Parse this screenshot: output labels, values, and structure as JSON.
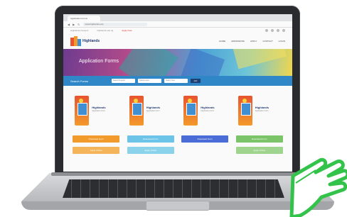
{
  "browser": {
    "tab_title": "Application Forms",
    "url": "www.highlands.edu"
  },
  "site": {
    "top_links": [
      "Highlands Campus",
      "highlands.edu.ng"
    ],
    "alert": "Apply Now",
    "logo_name": "Highlands",
    "menu": [
      "HOME",
      "ADMISSIONS",
      "APPLY",
      "CONTACT",
      "LOGIN"
    ],
    "hero_title": "Application Forms",
    "search_label": "Search Forms",
    "search_fields": [
      "Select Program",
      "Select Level",
      "Select Year"
    ],
    "search_button": "GO",
    "cards": [
      {
        "brand": "Highlands",
        "subtitle": "Application Form"
      },
      {
        "brand": "Highlands",
        "subtitle": "Application Form"
      },
      {
        "brand": "Highlands",
        "subtitle": "Application Form"
      },
      {
        "brand": "Highlands",
        "subtitle": "Application Form"
      }
    ],
    "buttons_row1": [
      {
        "label": "Download Form",
        "color": "#f39a2c"
      },
      {
        "label": "Download Form",
        "color": "#6cc5e8"
      },
      {
        "label": "Download Form",
        "color": "#4b6cd6"
      },
      {
        "label": "Download Form",
        "color": "#7cc46a"
      }
    ],
    "buttons_row2": [
      {
        "label": "Apply Online",
        "color": "#f3b45a"
      },
      {
        "label": "Apply Online",
        "color": "#8ad3ea"
      },
      {
        "label": "",
        "color": "#fafafa"
      },
      {
        "label": "Apply Online",
        "color": "#9ed48d"
      }
    ]
  },
  "colors": {
    "accent_blue": "#2f87c8",
    "cursor_green": "#33c24a"
  },
  "icons": [
    "back-icon",
    "forward-icon",
    "reload-icon",
    "hand-pointer-icon"
  ]
}
